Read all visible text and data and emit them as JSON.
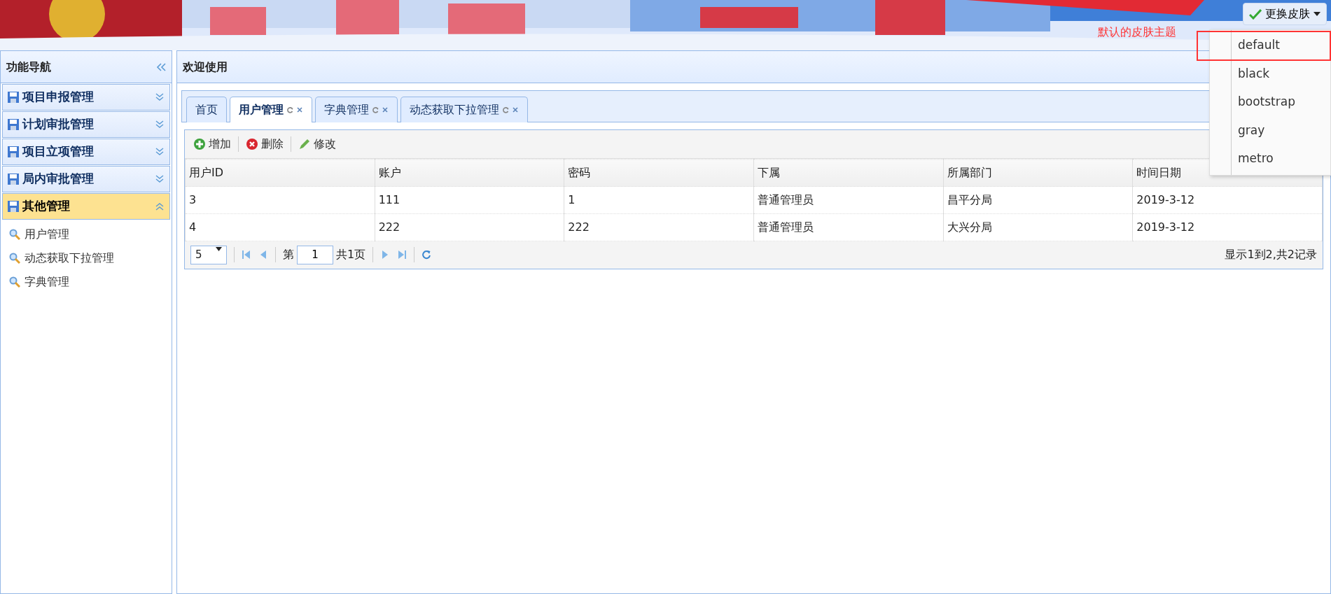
{
  "header": {
    "kind": "picture",
    "annotation": "默认的皮肤主题",
    "skin_button": {
      "label": "更换皮肤"
    }
  },
  "skin_menu": {
    "items": [
      {
        "label": "default",
        "annotated": true
      },
      {
        "label": "black",
        "annotated": false
      },
      {
        "label": "bootstrap",
        "annotated": false
      },
      {
        "label": "gray",
        "annotated": false
      },
      {
        "label": "metro",
        "annotated": false
      }
    ]
  },
  "sidebar": {
    "title": "功能导航",
    "sections": [
      {
        "label": "项目申报管理",
        "expanded": false
      },
      {
        "label": "计划审批管理",
        "expanded": false
      },
      {
        "label": "项目立项管理",
        "expanded": false
      },
      {
        "label": "局内审批管理",
        "expanded": false
      },
      {
        "label": "其他管理",
        "expanded": true,
        "items": [
          "用户管理",
          "动态获取下拉管理",
          "字典管理"
        ]
      }
    ]
  },
  "main": {
    "title": "欢迎使用",
    "tabs": [
      {
        "label": "首页",
        "selected": false,
        "closable": false
      },
      {
        "label": "用户管理",
        "selected": true,
        "closable": true
      },
      {
        "label": "字典管理",
        "selected": false,
        "closable": true
      },
      {
        "label": "动态获取下拉管理",
        "selected": false,
        "closable": true
      }
    ],
    "toolbar": [
      {
        "label": "增加",
        "kind": "add"
      },
      {
        "label": "删除",
        "kind": "delete"
      },
      {
        "label": "修改",
        "kind": "edit"
      }
    ],
    "table": {
      "columns": [
        "用户ID",
        "账户",
        "密码",
        "下属",
        "所属部门",
        "时间日期"
      ],
      "rows": [
        [
          "3",
          "111",
          "1",
          "普通管理员",
          "昌平分局",
          "2019-3-12"
        ],
        [
          "4",
          "222",
          "222",
          "普通管理员",
          "大兴分局",
          "2019-3-12"
        ]
      ]
    },
    "pager": {
      "page_size": "5",
      "page_label": "第",
      "page": "1",
      "total_label": "共1页",
      "summary": "显示1到2,共2记录"
    }
  }
}
